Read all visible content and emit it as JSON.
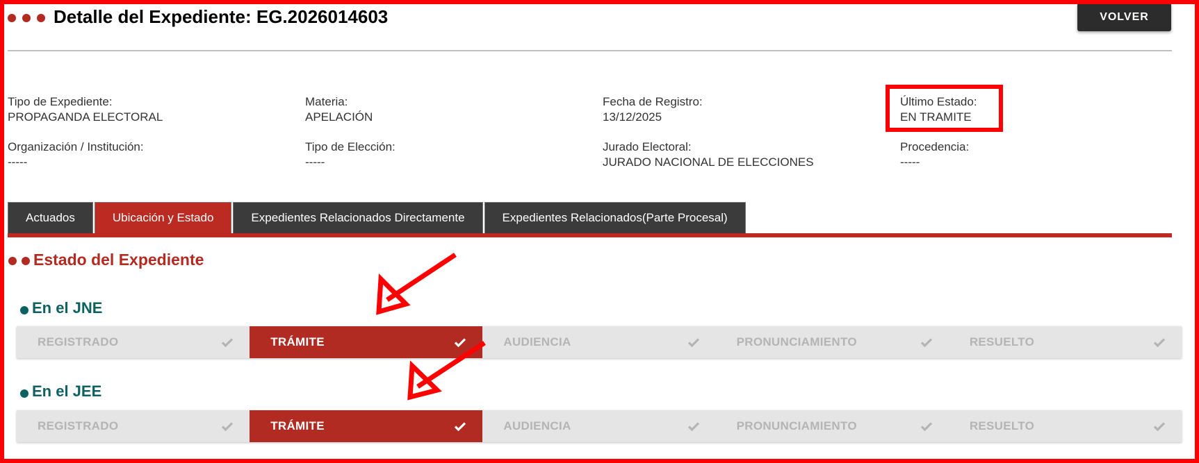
{
  "header": {
    "title": "Detalle del Expediente: EG.2026014603",
    "back_button": "VOLVER"
  },
  "fields": [
    {
      "label": "Tipo de Expediente:",
      "value": "PROPAGANDA ELECTORAL"
    },
    {
      "label": "Materia:",
      "value": "APELACIÓN"
    },
    {
      "label": "Fecha de Registro:",
      "value": "13/12/2025"
    },
    {
      "label": "Último Estado:",
      "value": "EN TRAMITE"
    },
    {
      "label": "Organización / Institución:",
      "value": "-----"
    },
    {
      "label": "Tipo de Elección:",
      "value": "-----"
    },
    {
      "label": "Jurado Electoral:",
      "value": "JURADO NACIONAL DE ELECCIONES"
    },
    {
      "label": "Procedencia:",
      "value": "-----"
    }
  ],
  "tabs": [
    {
      "label": "Actuados",
      "active": false
    },
    {
      "label": "Ubicación y Estado",
      "active": true
    },
    {
      "label": "Expedientes Relacionados Directamente",
      "active": false
    },
    {
      "label": "Expedientes Relacionados(Parte Procesal)",
      "active": false
    }
  ],
  "section": {
    "title": "Estado del Expediente",
    "trackers": [
      {
        "title": "En el JNE",
        "steps": [
          {
            "label": "REGISTRADO",
            "active": false
          },
          {
            "label": "TRÁMITE",
            "active": true
          },
          {
            "label": "AUDIENCIA",
            "active": false
          },
          {
            "label": "PRONUNCIAMIENTO",
            "active": false
          },
          {
            "label": "RESUELTO",
            "active": false
          }
        ]
      },
      {
        "title": "En el JEE",
        "steps": [
          {
            "label": "REGISTRADO",
            "active": false
          },
          {
            "label": "TRÁMITE",
            "active": true
          },
          {
            "label": "AUDIENCIA",
            "active": false
          },
          {
            "label": "PRONUNCIAMIENTO",
            "active": false
          },
          {
            "label": "RESUELTO",
            "active": false
          }
        ]
      }
    ]
  },
  "colors": {
    "accent_red": "#b22b22",
    "teal": "#0e6161",
    "annotation_red": "#ff0000",
    "tab_dark": "#3b3b3b"
  }
}
